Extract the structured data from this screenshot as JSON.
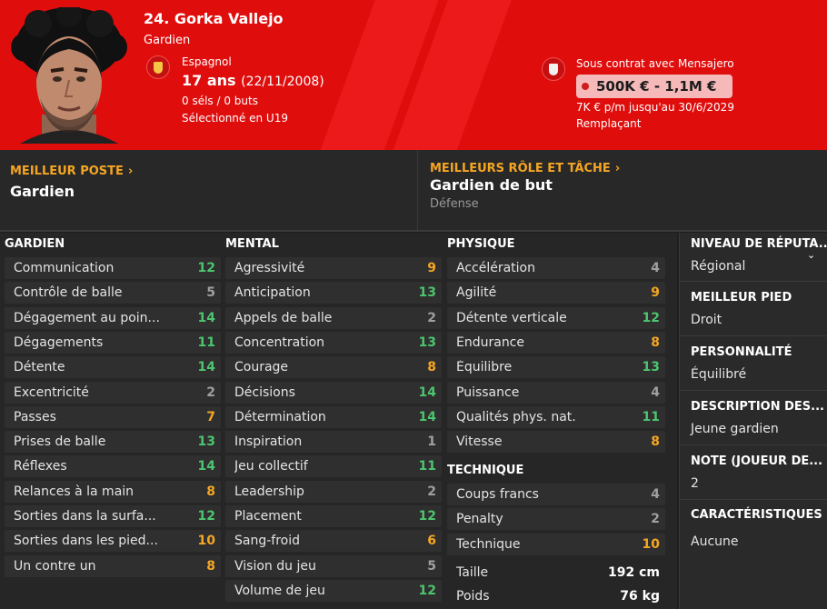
{
  "player": {
    "name": "24. Gorka Vallejo",
    "position": "Gardien",
    "nationality": "Espagnol",
    "age": "17 ans",
    "birth": "(22/11/2008)",
    "caps": "0 séls / 0 buts",
    "selection": "Sélectionné en U19",
    "contract": "Sous contrat avec Mensajero",
    "value": "500K € - 1,1M €",
    "wage": "7K € p/m jusqu'au 30/6/2029",
    "squad_status": "Remplaçant"
  },
  "best_position": {
    "title": "MEILLEUR POSTE",
    "value": "Gardien"
  },
  "best_role": {
    "title": "MEILLEURS RÔLE ET TÂCHE",
    "value": "Gardien de but",
    "duty": "Défense"
  },
  "attributes": {
    "gardien": {
      "title": "GARDIEN",
      "rows": [
        {
          "label": "Communication",
          "value": "12"
        },
        {
          "label": "Contrôle de balle",
          "value": "5"
        },
        {
          "label": "Dégagement au poin...",
          "value": "14"
        },
        {
          "label": "Dégagements",
          "value": "11"
        },
        {
          "label": "Détente",
          "value": "14"
        },
        {
          "label": "Excentricité",
          "value": "2"
        },
        {
          "label": "Passes",
          "value": "7"
        },
        {
          "label": "Prises de balle",
          "value": "13"
        },
        {
          "label": "Réflexes",
          "value": "14"
        },
        {
          "label": "Relances à la main",
          "value": "8"
        },
        {
          "label": "Sorties dans la surfa...",
          "value": "12"
        },
        {
          "label": "Sorties dans les pied...",
          "value": "10"
        },
        {
          "label": "Un contre un",
          "value": "8"
        }
      ]
    },
    "mental": {
      "title": "MENTAL",
      "rows": [
        {
          "label": "Agressivité",
          "value": "9"
        },
        {
          "label": "Anticipation",
          "value": "13"
        },
        {
          "label": "Appels de balle",
          "value": "2"
        },
        {
          "label": "Concentration",
          "value": "13"
        },
        {
          "label": "Courage",
          "value": "8"
        },
        {
          "label": "Décisions",
          "value": "14"
        },
        {
          "label": "Détermination",
          "value": "14"
        },
        {
          "label": "Inspiration",
          "value": "1"
        },
        {
          "label": "Jeu collectif",
          "value": "11"
        },
        {
          "label": "Leadership",
          "value": "2"
        },
        {
          "label": "Placement",
          "value": "12"
        },
        {
          "label": "Sang-froid",
          "value": "6"
        },
        {
          "label": "Vision du jeu",
          "value": "5"
        },
        {
          "label": "Volume de jeu",
          "value": "12"
        }
      ]
    },
    "physique": {
      "title": "PHYSIQUE",
      "rows": [
        {
          "label": "Accélération",
          "value": "4"
        },
        {
          "label": "Agilité",
          "value": "9"
        },
        {
          "label": "Détente verticale",
          "value": "12"
        },
        {
          "label": "Endurance",
          "value": "8"
        },
        {
          "label": "Équilibre",
          "value": "13"
        },
        {
          "label": "Puissance",
          "value": "4"
        },
        {
          "label": "Qualités phys. nat.",
          "value": "11"
        },
        {
          "label": "Vitesse",
          "value": "8"
        }
      ]
    },
    "technique": {
      "title": "TECHNIQUE",
      "rows": [
        {
          "label": "Coups francs",
          "value": "4"
        },
        {
          "label": "Penalty",
          "value": "2"
        },
        {
          "label": "Technique",
          "value": "10"
        }
      ]
    },
    "physical_info": [
      {
        "label": "Taille",
        "value": "192 cm"
      },
      {
        "label": "Poids",
        "value": "76 kg"
      }
    ]
  },
  "side": {
    "reputation": {
      "title": "NIVEAU DE RÉPUTA...",
      "value": "Régional"
    },
    "foot": {
      "title": "MEILLEUR PIED",
      "value": "Droit"
    },
    "personality": {
      "title": "PERSONNALITÉ",
      "value": "Équilibré"
    },
    "description": {
      "title": "DESCRIPTION DES...",
      "value": "Jeune gardien"
    },
    "rating": {
      "title": "NOTE (JOUEUR DE...",
      "value": "2"
    },
    "traits": {
      "title": "CARACTÉRISTIQUES",
      "value": "Aucune"
    }
  },
  "colors": {
    "header_red": "#e00d0d",
    "accent_gold": "#f5a623",
    "good_green": "#4cc56f"
  }
}
